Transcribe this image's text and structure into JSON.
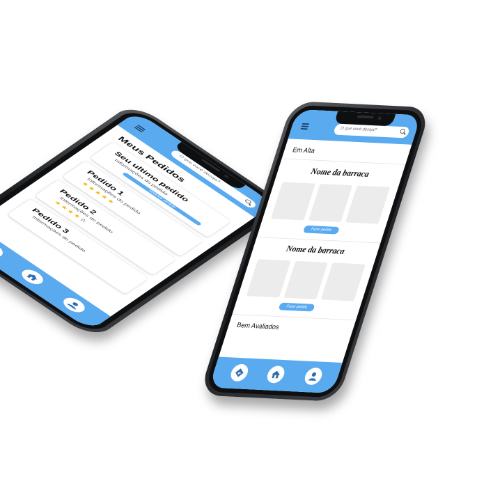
{
  "colors": {
    "accent": "#5aaaf0",
    "tile": "#ececec",
    "star": "#f2b705"
  },
  "phone_left": {
    "search": {
      "placeholder": "O que você deseja?"
    },
    "title": "Meus Pedidos",
    "last_order": {
      "title": "Seu ultimo pedido",
      "info": "Informações do pedido",
      "button": "Solicitar pedido"
    },
    "orders": [
      {
        "title": "Pedido 1",
        "info": "Informações do pedido",
        "stars_filled": "★★★★★",
        "stars_empty": "",
        "rating": 5
      },
      {
        "title": "Pedido 2",
        "info": "Informações do pedido",
        "stars_filled": "★★★★",
        "stars_empty": "☆",
        "rating": 4
      },
      {
        "title": "Pedido 3",
        "info": "Informações do pedido"
      }
    ],
    "nav_icons": [
      "map-icon",
      "home-icon",
      "user-icon"
    ]
  },
  "phone_right": {
    "search": {
      "placeholder": "O que você deseja?"
    },
    "trending_label": "Em Alta",
    "stores": [
      {
        "name": "Nome da barraca",
        "button": "Fazer pedido"
      },
      {
        "name": "Nome da barraca",
        "button": "Fazer pedido"
      }
    ],
    "rated_label": "Bem Avaliados",
    "nav_icons": [
      "map-icon",
      "home-icon",
      "user-icon"
    ]
  }
}
